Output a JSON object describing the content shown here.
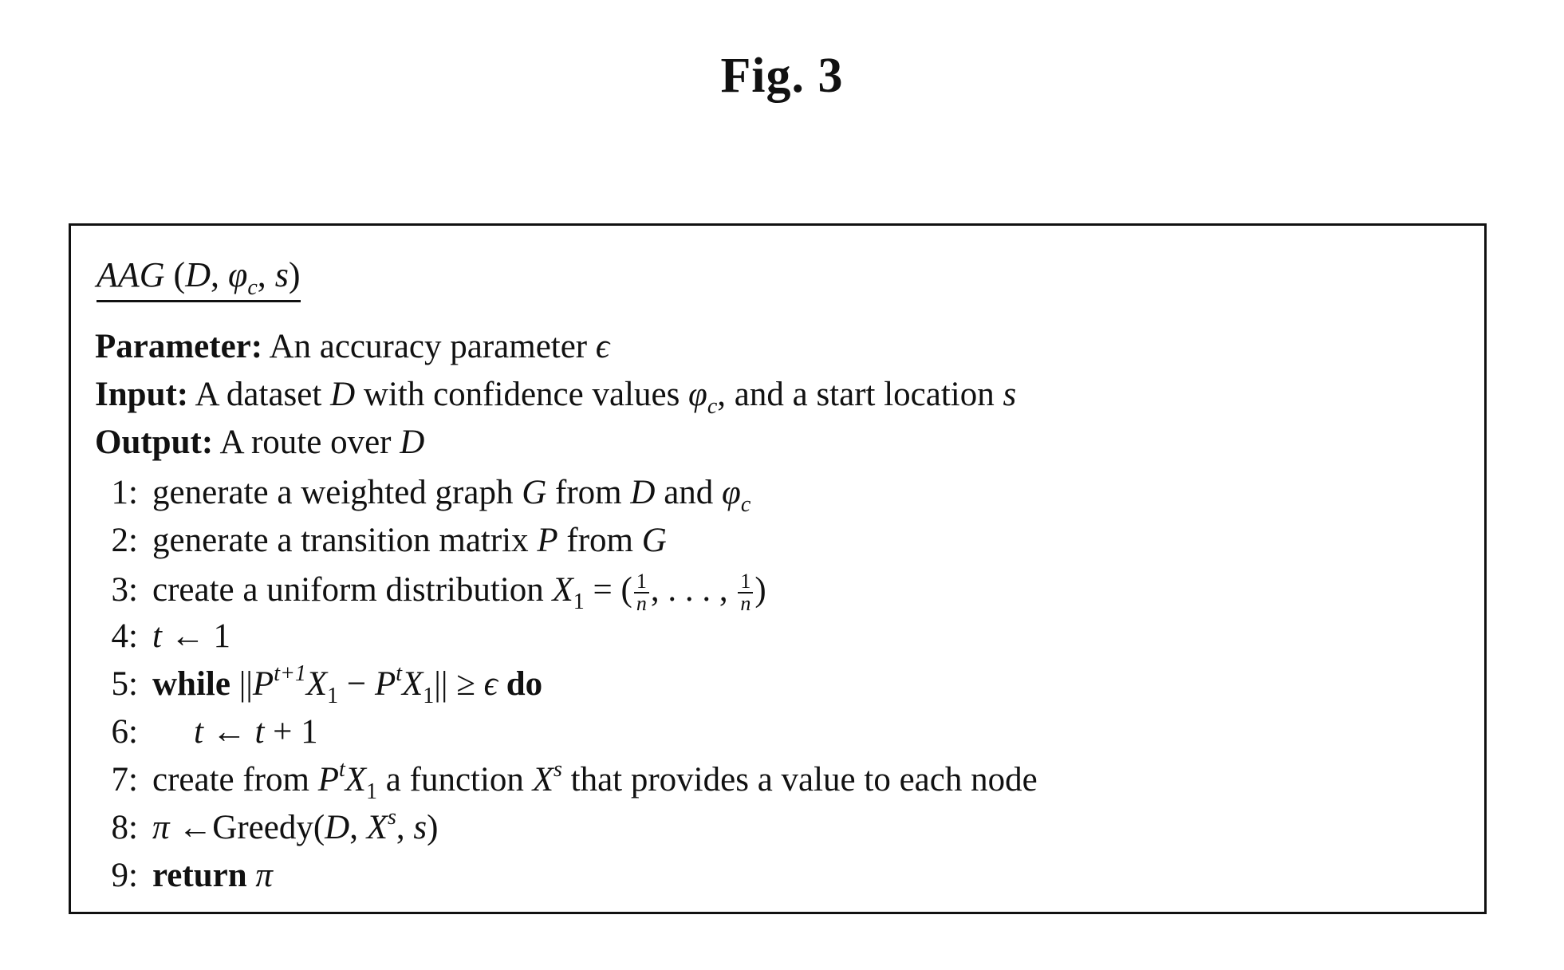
{
  "figure": {
    "title": "Fig. 3"
  },
  "algorithm": {
    "name": "AAG",
    "signature": {
      "open": "(",
      "arg1": "D",
      "sep1": ", ",
      "arg2_base": "φ",
      "arg2_sub": "c",
      "sep2": ", ",
      "arg3": "s",
      "close": ")"
    },
    "parameter": {
      "label": "Parameter:",
      "text": " An accuracy parameter ",
      "symbol": "ϵ"
    },
    "input": {
      "label": "Input:",
      "text1": " A dataset ",
      "var_D": "D",
      "text2": " with confidence values ",
      "phi": "φ",
      "phi_sub": "c",
      "text3": ", and a start location ",
      "var_s": "s"
    },
    "output": {
      "label": "Output:",
      "text": " A route over ",
      "var_D": "D"
    },
    "steps": [
      {
        "num": "1:",
        "t1": "generate a weighted graph ",
        "G": "G",
        "t2": " from ",
        "D": "D",
        "t3": " and ",
        "phi": "φ",
        "phi_sub": "c"
      },
      {
        "num": "2:",
        "t1": "generate a transition matrix ",
        "P": "P",
        "t2": " from ",
        "G": "G"
      },
      {
        "num": "3:",
        "t1": "create a uniform distribution ",
        "X": "X",
        "X_sub": "1",
        "eq": " = (",
        "frac_num": "1",
        "frac_den": "n",
        "dots": ", . . . , ",
        "close": ")"
      },
      {
        "num": "4:",
        "t": "t",
        "arrow": " ← ",
        "val": "1"
      },
      {
        "num": "5:",
        "kw": "while",
        "norm_open": " ||",
        "P": "P",
        "P_sup": "t+1",
        "X": "X",
        "X_sub": "1",
        "minus": " − ",
        "P2": "P",
        "P2_sup": "t",
        "X2": "X",
        "X2_sub": "1",
        "norm_close": "|| ≥ ",
        "eps": "ϵ",
        "kw2": " do"
      },
      {
        "num": "6:",
        "t": "t",
        "arrow": " ← ",
        "t2": "t",
        "plus": " + 1"
      },
      {
        "num": "7:",
        "t1": "create from ",
        "P": "P",
        "P_sup": "t",
        "X": "X",
        "X_sub": "1",
        "t2": " a function ",
        "Xs": "X",
        "Xs_sup": "s",
        "t3": " that provides a value to each node"
      },
      {
        "num": "8:",
        "pi": "π",
        "arrow": " ←",
        "fn": "Greedy(",
        "D": "D",
        "c1": ", ",
        "X": "X",
        "X_sup": "s",
        "c2": ", ",
        "s": "s",
        "close": ")"
      },
      {
        "num": "9:",
        "kw": "return",
        "pi": " π"
      }
    ]
  }
}
